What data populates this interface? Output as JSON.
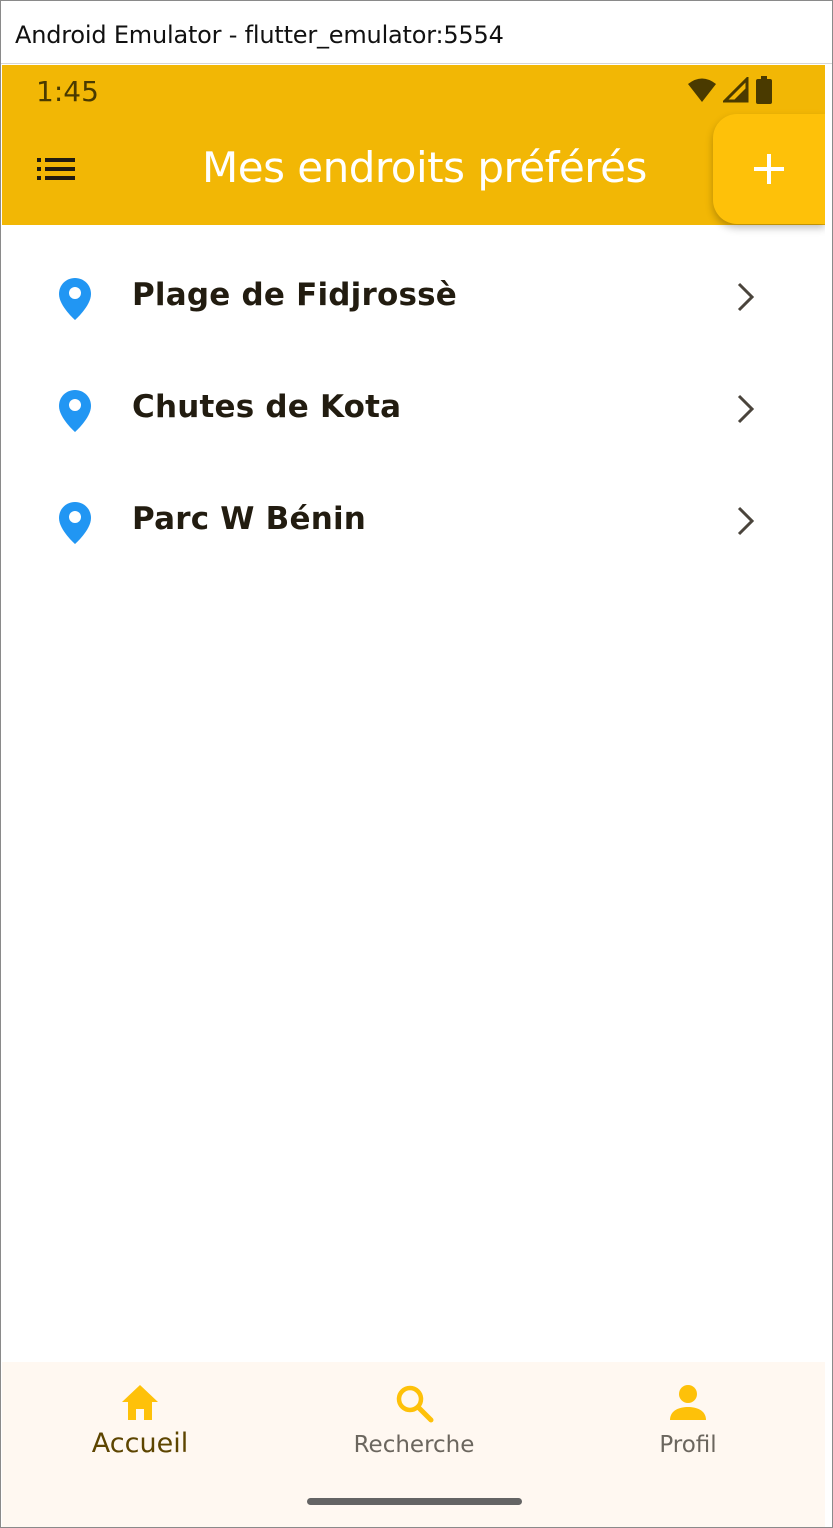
{
  "window": {
    "title": "Android Emulator - flutter_emulator:5554"
  },
  "status_bar": {
    "time": "1:45",
    "icons": [
      "wifi-icon",
      "cell-signal-icon",
      "battery-icon"
    ]
  },
  "app_bar": {
    "title": "Mes endroits préférés",
    "menu_icon": "list-icon",
    "add_icon": "plus-icon",
    "background_color": "#f2b705",
    "add_button_color": "#fec109"
  },
  "places": [
    {
      "name": "Plage de Fidjrossè",
      "icon": "location-pin-icon"
    },
    {
      "name": "Chutes de Kota",
      "icon": "location-pin-icon"
    },
    {
      "name": "Parc W Bénin",
      "icon": "location-pin-icon"
    }
  ],
  "bottom_nav": {
    "items": [
      {
        "label": "Accueil",
        "icon": "home-icon",
        "active": true
      },
      {
        "label": "Recherche",
        "icon": "search-icon",
        "active": false
      },
      {
        "label": "Profil",
        "icon": "person-icon",
        "active": false
      }
    ],
    "accent_color": "#fec109"
  },
  "colors": {
    "pin": "#2196f3"
  }
}
